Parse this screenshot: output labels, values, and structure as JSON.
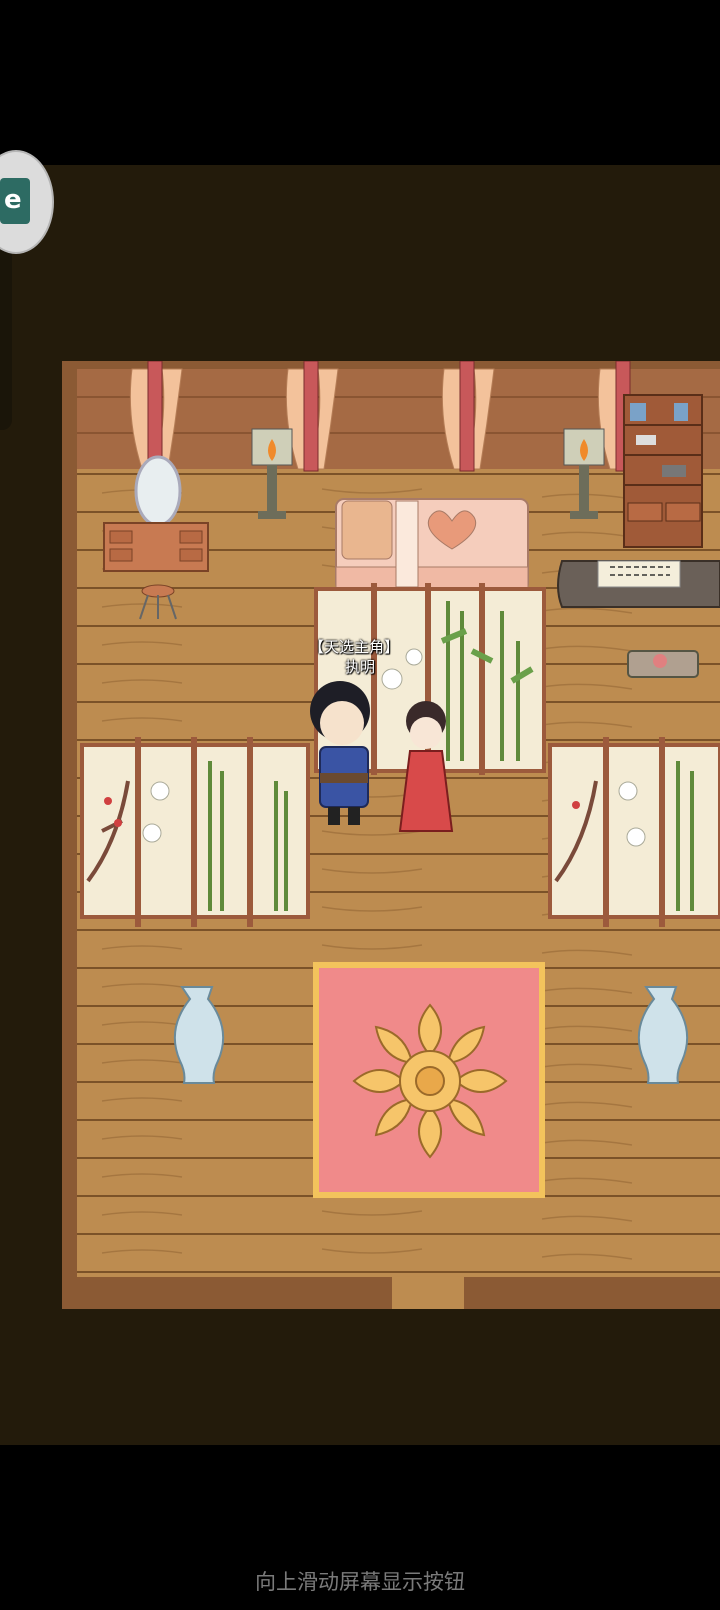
{
  "character": {
    "title_label": "【天选主角】",
    "name_label": "执明"
  },
  "footer": {
    "hint_text": "向上滑动屏幕显示按钮"
  },
  "floating_button": {
    "icon": "game-menu-icon"
  },
  "colors": {
    "floor": "#b8894d",
    "wall": "#a56a44",
    "background": "#231b0b",
    "rug": "#f08a8a"
  }
}
